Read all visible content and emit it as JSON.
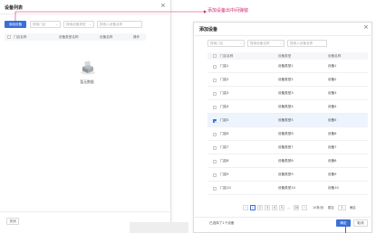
{
  "list_modal": {
    "title": "设备列表",
    "add_button": "添加设备",
    "store_select": "搜索门店",
    "type_select": "搜索设备类型",
    "search_placeholder": "搜索入设备名称",
    "columns": [
      "门店名称",
      "设备类型名称",
      "设备名称",
      "操作"
    ],
    "empty_text": "暂无数据",
    "close_button": "关闭"
  },
  "annotation": {
    "text": "添加设备出中间弹窗",
    "color": "#d0276f"
  },
  "add_modal": {
    "title": "添加设备",
    "store_select": "搜索门店",
    "type_select": "搜索设备名称",
    "search_placeholder": "搜索入设备名称",
    "columns": [
      "门店名称",
      "设备类型",
      "设备名称"
    ],
    "rows": [
      {
        "store": "门店1",
        "type": "设备类型1",
        "name": "设备1",
        "checked": false
      },
      {
        "store": "门店2",
        "type": "设备类型2",
        "name": "设备2",
        "checked": false
      },
      {
        "store": "门店3",
        "type": "设备类型3",
        "name": "设备3",
        "checked": false
      },
      {
        "store": "门店4",
        "type": "设备类型4",
        "name": "设备4",
        "checked": false
      },
      {
        "store": "门店5",
        "type": "设备类型5",
        "name": "设备5",
        "checked": true
      },
      {
        "store": "门店6",
        "type": "设备类型6",
        "name": "设备6",
        "checked": false
      },
      {
        "store": "门店7",
        "type": "设备类型7",
        "name": "设备7",
        "checked": false
      },
      {
        "store": "门店8",
        "type": "设备类型8",
        "name": "设备8",
        "checked": false
      },
      {
        "store": "门店9",
        "type": "设备类型9",
        "name": "设备9",
        "checked": false
      },
      {
        "store": "门店10",
        "type": "设备类型10",
        "name": "设备10",
        "checked": false
      }
    ],
    "pagination": {
      "prev": "‹",
      "pages": [
        "1",
        "2",
        "3",
        "4",
        "5",
        "...",
        "10",
        "›"
      ],
      "current_page": "1",
      "page_size": "10条/页",
      "goto_label": "跳至",
      "goto_value": "1",
      "confirm": "确定"
    },
    "selected_text": "已选择了1个设备",
    "ok_button": "确定",
    "cancel_button": "取消"
  },
  "colors": {
    "primary": "#3a6fd8",
    "highlight_row": "#eef4fe"
  }
}
